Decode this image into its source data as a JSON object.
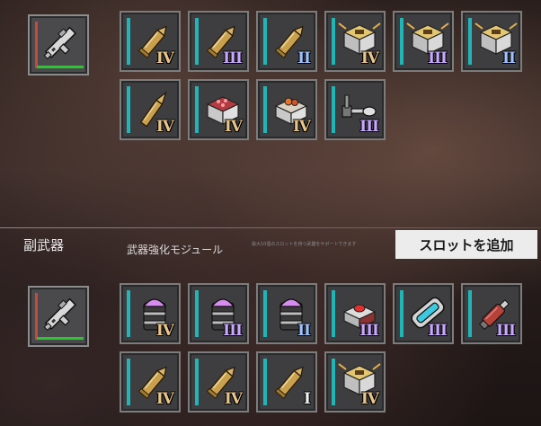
{
  "secondary_weapon": {
    "title": "副武器",
    "module_label": "武器強化モジュール",
    "hint": "最大10個のスロットを持つ武器をサポートできます",
    "add_slot_button": "スロットを追加"
  },
  "colors": {
    "gold": "#e9c48a",
    "purple": "#c9a8ff",
    "blue": "#9fc2ff",
    "white": "#f0f0f0",
    "accent_bar": "#22b5b8"
  },
  "primary_slots": [
    {
      "icon": "bullet-icon",
      "tier": "IV",
      "tier_color": "gold"
    },
    {
      "icon": "bullet-icon",
      "tier": "III",
      "tier_color": "purple"
    },
    {
      "icon": "bullet-icon",
      "tier": "II",
      "tier_color": "blue"
    },
    {
      "icon": "ammo-crate-icon",
      "tier": "IV",
      "tier_color": "gold"
    },
    {
      "icon": "ammo-crate-icon",
      "tier": "III",
      "tier_color": "purple"
    },
    {
      "icon": "ammo-crate-icon",
      "tier": "II",
      "tier_color": "blue"
    },
    {
      "icon": "long-bullet-icon",
      "tier": "IV",
      "tier_color": "gold"
    },
    {
      "icon": "red-crate-icon",
      "tier": "IV",
      "tier_color": "gold"
    },
    {
      "icon": "orange-crate-icon",
      "tier": "IV",
      "tier_color": "gold"
    },
    {
      "icon": "scope-mount-icon",
      "tier": "III",
      "tier_color": "purple"
    }
  ],
  "secondary_slots": [
    {
      "icon": "purple-shell-icon",
      "tier": "IV",
      "tier_color": "gold"
    },
    {
      "icon": "purple-shell-icon",
      "tier": "III",
      "tier_color": "purple"
    },
    {
      "icon": "purple-shell-icon",
      "tier": "II",
      "tier_color": "blue"
    },
    {
      "icon": "red-button-crate-icon",
      "tier": "III",
      "tier_color": "purple"
    },
    {
      "icon": "magazine-icon",
      "tier": "III",
      "tier_color": "purple"
    },
    {
      "icon": "syringe-icon",
      "tier": "III",
      "tier_color": "purple"
    },
    {
      "icon": "bullet-icon",
      "tier": "IV",
      "tier_color": "gold"
    },
    {
      "icon": "bullet-icon",
      "tier": "IV",
      "tier_color": "gold"
    },
    {
      "icon": "bullet-icon",
      "tier": "I",
      "tier_color": "white"
    },
    {
      "icon": "ammo-crate-icon",
      "tier": "IV",
      "tier_color": "gold"
    }
  ]
}
